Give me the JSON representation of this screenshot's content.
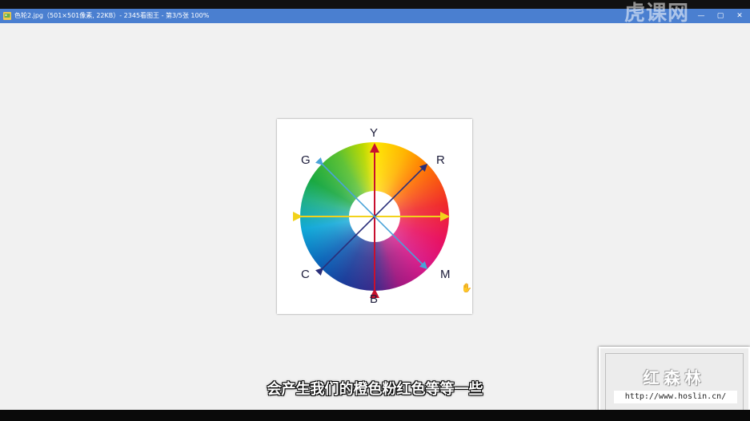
{
  "window": {
    "title": "色轮2.jpg（501×501像素, 22KB）- 2345看图王 - 第3/5张 100%",
    "brand": "虎课网",
    "buttons": {
      "minimize": "—",
      "restore": "▢",
      "close": "✕"
    }
  },
  "color_wheel": {
    "labels": {
      "top": "Y",
      "top_right": "R",
      "right_bottom": "M",
      "bottom": "B",
      "left_bottom": "C",
      "top_left": "G"
    },
    "arrow_colors": {
      "vertical": "#c8102e",
      "horizontal": "#f2d21b",
      "diag_up": "#2a2f7a",
      "diag_down": "#4aa3d8"
    }
  },
  "subtitle": "会产生我们的橙色粉红色等等一些",
  "watermark": {
    "name": "红森林",
    "url": "http://www.hoslin.cn/"
  },
  "colors": {
    "titlebar": "#4a7fd0",
    "viewer_bg": "#f1f1f1"
  }
}
